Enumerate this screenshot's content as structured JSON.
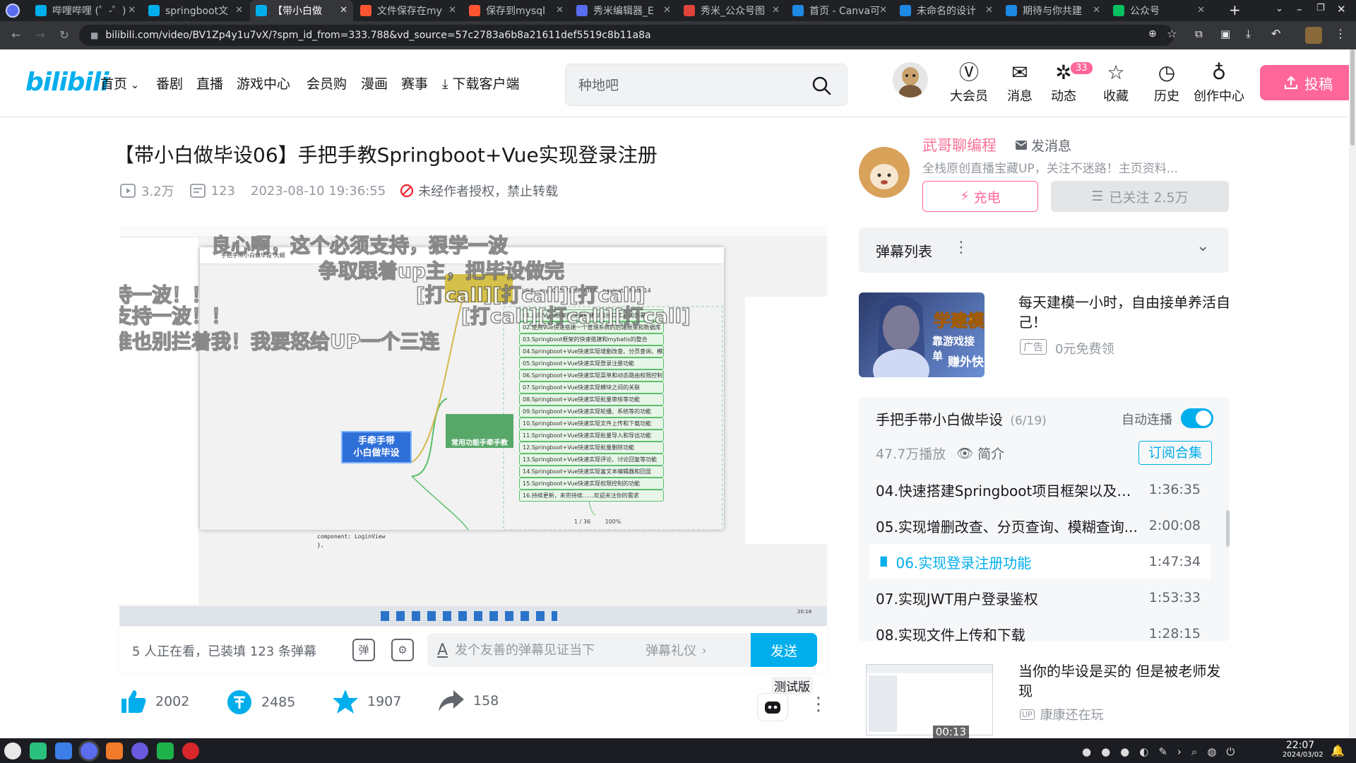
{
  "browser": {
    "tabs": [
      {
        "title": "哔哩哔哩 (゜-゜)",
        "icon": "bilibili-icon",
        "color": "#00aeec"
      },
      {
        "title": "springboot文",
        "icon": "bilibili-icon",
        "color": "#00aeec"
      },
      {
        "title": "【带小白做",
        "icon": "bilibili-icon",
        "color": "#00aeec",
        "active": true
      },
      {
        "title": "文件保存在my",
        "icon": "csdn-icon",
        "color": "#fc5531"
      },
      {
        "title": "保存到mysql",
        "icon": "csdn-icon",
        "color": "#fc5531"
      },
      {
        "title": "秀米编辑器_E",
        "icon": "xiumi-icon",
        "color": "#5a6cf0"
      },
      {
        "title": "秀米_公众号图",
        "icon": "xiumi-icon",
        "color": "#e0443a"
      },
      {
        "title": "首页 - Canva可",
        "icon": "canva-icon",
        "color": "#1e88e5"
      },
      {
        "title": "未命名的设计",
        "icon": "canva-icon",
        "color": "#1e88e5"
      },
      {
        "title": "期待与你共建",
        "icon": "canva-icon",
        "color": "#1e88e5"
      },
      {
        "title": "公众号",
        "icon": "wechat-icon",
        "color": "#07c160"
      }
    ],
    "url": "bilibili.com/video/BV1Zp4y1u7vX/?spm_id_from=333.788&vd_source=57c2783a6b8a21611def5519c8b11a8a"
  },
  "header": {
    "logo": "bilibili",
    "nav": [
      "首页",
      "番剧",
      "直播",
      "游戏中心",
      "会员购",
      "漫画",
      "赛事",
      "下载客户端"
    ],
    "search_placeholder": "种地吧",
    "icons": [
      {
        "label": "大会员",
        "icon": "vip-icon"
      },
      {
        "label": "消息",
        "icon": "message-icon"
      },
      {
        "label": "动态",
        "icon": "dynamic-icon",
        "badge": "33"
      },
      {
        "label": "收藏",
        "icon": "star-icon"
      },
      {
        "label": "历史",
        "icon": "history-icon"
      },
      {
        "label": "创作中心",
        "icon": "creator-icon"
      }
    ],
    "upload_label": "投稿"
  },
  "video": {
    "title": "【带小白做毕设06】手把手教Springboot+Vue实现登录注册",
    "views": "3.2万",
    "danmaku_count": "123",
    "date": "2023-08-10 19:36:55",
    "copyright": "未经作者授权，禁止转载"
  },
  "player": {
    "app_title": "手把手带小白做毕设 大纲",
    "center_node": "手牵手带\n小白做毕设",
    "mid_node": "常用功能手牵手教",
    "env_node": "jdk8、mySQL5.7或8、IDEA、navicat、Node14",
    "chapters": [
      "01.后端Vue 框架的快速搭建以及接口工程的部署",
      "02.使用Vue快速搭建一个管理系统的后端框架和数据库",
      "03.Springboot框架的快速搭建和mybatis的整合",
      "04.Springboot+Vue快速实现增删改查、分页查询、模糊",
      "05.Springboot+Vue快速实现登录注册功能",
      "06.Springboot+Vue快速实现菜单和动态路由权限控制",
      "07.Springboot+Vue快速实现模块之间的关联",
      "08.Springboot+Vue快速实现批量审核等功能",
      "09.Springboot+Vue快速实现轮播、系统等的功能",
      "10.Springboot+Vue快速实现文件上传和下载功能",
      "11.Springboot+Vue快速实现批量导入和导出功能",
      "12.Springboot+Vue快速实现批量删除功能",
      "13.Springboot+Vue快速实现评论、讨论回复等功能",
      "14.Springboot+Vue快速实现富文本编辑器和回显",
      "15.Springboot+Vue快速实现权限控制的功能",
      "16.持续更新，未完待续……欢迎关注你的需求"
    ],
    "danmaku": [
      "良心啊，这个必须支持，狠学一波",
      "争取跟着up主，把毕设做完",
      "[打call][打call][打call]",
      "[打call][打call][打call]",
      "持一波！！",
      "支持一波！！",
      "谁也别拦着我！我要怒给UP一个三连"
    ],
    "code_lines": [
      "component: LoginView",
      "},"
    ],
    "status_page": "1 / 36",
    "status_zoom": "100%",
    "clock": "20:18"
  },
  "sendbar": {
    "watching": "5 人正在看，已装填 123 条弹幕",
    "input_placeholder": "发个友善的弹幕见证当下",
    "etiquette": "弹幕礼仪",
    "send_label": "发送"
  },
  "actions": {
    "like": "2002",
    "coin": "2485",
    "fav": "1907",
    "share": "158",
    "beta_label": "测试版"
  },
  "uploader": {
    "name": "武哥聊编程",
    "message_label": "发消息",
    "desc": "全栈原创直播宝藏UP，关注不迷路！主页资料...",
    "charge_label": "充电",
    "follow_label": "已关注 2.5万"
  },
  "danmaku_list": {
    "label": "弹幕列表"
  },
  "ad": {
    "title": "每天建模一小时，自由接单养活自己！",
    "tag": "广告",
    "sub": "0元免费领",
    "thumb_text_1": "学建模",
    "thumb_text_2": "靠游戏接单",
    "thumb_text_3": "赚外快"
  },
  "playlist": {
    "title": "手把手带小白做毕设",
    "progress": "(6/19)",
    "autoplay_label": "自动连播",
    "autoplay_on": true,
    "plays": "47.7万播放",
    "intro_label": "简介",
    "subscribe_label": "订阅合集",
    "episodes": [
      {
        "name": "04.快速搭建Springboot项目框架以及S...",
        "dur": "1:36:35",
        "current": false
      },
      {
        "name": "05.实现增删改查、分页查询、模糊查询...",
        "dur": "2:00:08",
        "current": false
      },
      {
        "name": "06.实现登录注册功能",
        "dur": "1:47:34",
        "current": true
      },
      {
        "name": "07.实现JWT用户登录鉴权",
        "dur": "1:53:33",
        "current": false
      },
      {
        "name": "08.实现文件上传和下载",
        "dur": "1:28:15",
        "current": false
      }
    ]
  },
  "recommend": {
    "title": "当你的毕设是买的 但是被老师发现",
    "author": "康康还在玩",
    "duration": "00:13"
  },
  "taskbar": {
    "time": "22:07",
    "date": "2024/03/02"
  },
  "colors": {
    "brand_blue": "#00aeec",
    "brand_pink": "#ff6699",
    "node_green": "#5bbf6c"
  }
}
